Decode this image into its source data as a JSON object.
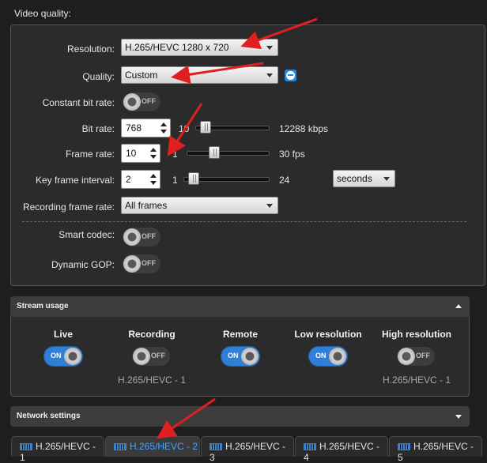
{
  "section_title": "Video quality:",
  "fields": {
    "resolution": {
      "label": "Resolution:",
      "value": "H.265/HEVC 1280 x 720"
    },
    "quality": {
      "label": "Quality:",
      "value": "Custom"
    },
    "constant_bit_rate": {
      "label": "Constant bit rate:",
      "toggle": "OFF"
    },
    "bit_rate": {
      "label": "Bit rate:",
      "value": "768",
      "min": "10",
      "max": "12288 kbps",
      "level": 0.06
    },
    "frame_rate": {
      "label": "Frame rate:",
      "value": "10",
      "min": "1",
      "max": "30 fps",
      "level": 0.31
    },
    "key_frame_interval": {
      "label": "Key frame interval:",
      "value": "2",
      "min": "1",
      "max": "24",
      "unit": "seconds",
      "level": 0.04
    },
    "recording_frame_rate": {
      "label": "Recording frame rate:",
      "value": "All frames"
    },
    "smart_codec": {
      "label": "Smart codec:",
      "toggle": "OFF"
    },
    "dynamic_gop": {
      "label": "Dynamic GOP:",
      "toggle": "OFF"
    }
  },
  "stream_usage": {
    "title": "Stream usage",
    "columns": [
      {
        "title": "Live",
        "toggle": "ON",
        "sub": ""
      },
      {
        "title": "Recording",
        "toggle": "OFF",
        "sub": "H.265/HEVC - 1"
      },
      {
        "title": "Remote",
        "toggle": "ON",
        "sub": ""
      },
      {
        "title": "Low resolution",
        "toggle": "ON",
        "sub": ""
      },
      {
        "title": "High resolution",
        "toggle": "OFF",
        "sub": "H.265/HEVC - 1"
      }
    ]
  },
  "network_settings": {
    "title": "Network settings"
  },
  "tabs": [
    {
      "label": "H.265/HEVC - 1",
      "active": false
    },
    {
      "label": "H.265/HEVC - 2",
      "active": true
    },
    {
      "label": "H.265/HEVC - 3",
      "active": false
    },
    {
      "label": "H.265/HEVC - 4",
      "active": false
    },
    {
      "label": "H.265/HEVC - 5",
      "active": false
    }
  ],
  "colors": {
    "accent": "#2f7fd6",
    "annotation_arrow": "#e02020",
    "active_tab_text": "#4aa3ff"
  },
  "icons": {
    "quality_button": "minus-circle-icon",
    "tab_icon": "stream-icon",
    "collapse": "chevron-up-icon",
    "expand": "chevron-down-icon"
  }
}
